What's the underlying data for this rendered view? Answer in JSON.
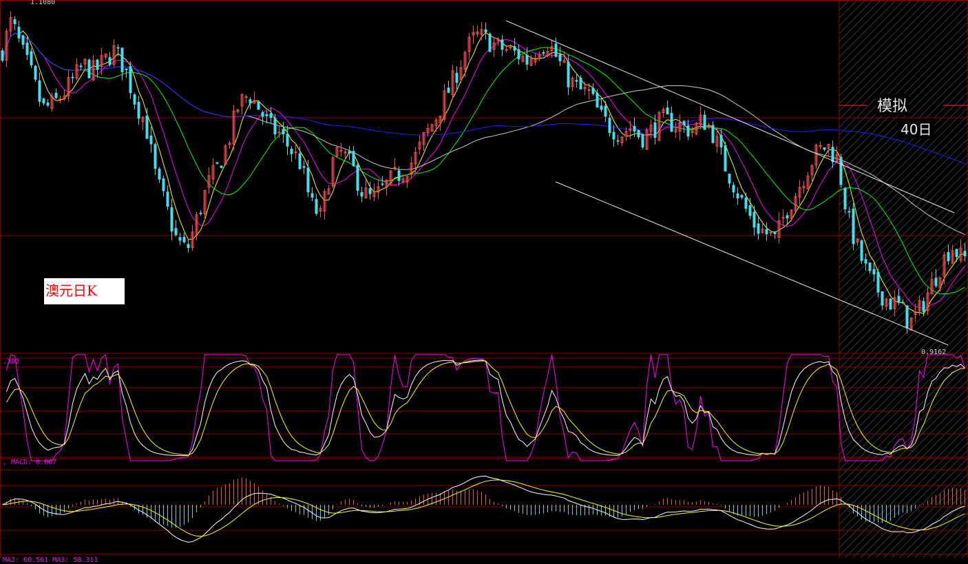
{
  "title_label": "澳元日K",
  "simulation": {
    "label": "模拟",
    "days": "40日"
  },
  "price_high_label": "1.1080",
  "price_low_label": "0.9162",
  "kdj_label": ".382",
  "macd_label": ", MACD: 0.007",
  "ma_label": "MA2: 60.561  MA3: 58.311",
  "colors": {
    "background": "#000000",
    "grid": "#8b0000",
    "candle_up": "#ff5050",
    "candle_down": "#40e0f0",
    "ma5": "#ffff00",
    "ma10": "#ff00ff",
    "ma20": "#00ff00",
    "ma60": "#cccccc",
    "ma120": "#2020ff",
    "trendline": "#e8e8e8"
  },
  "chart_data": [
    {
      "type": "candlestick",
      "title": "澳元日K",
      "ylim": [
        0.9162,
        1.108
      ],
      "y_max_label": "1.1080",
      "y_min_label": "0.9162",
      "simulation_period_days": 40,
      "trend": {
        "x_index": [
          0,
          15,
          30,
          45,
          60,
          75,
          90,
          105,
          120,
          135,
          150,
          165,
          180,
          195,
          210,
          225,
          240,
          255,
          270,
          285,
          300,
          315,
          330,
          345,
          360,
          375,
          390,
          405,
          420,
          435,
          450,
          465,
          480,
          495,
          510,
          525,
          540,
          555,
          570,
          585,
          600,
          615,
          630,
          645,
          660,
          675,
          690,
          705,
          720,
          735,
          750,
          765,
          780,
          795,
          810,
          825,
          840,
          855,
          870,
          885,
          900,
          915,
          930,
          945,
          960,
          975,
          990,
          1005,
          1020,
          1035,
          1050,
          1065,
          1080,
          1095,
          1110,
          1125,
          1140,
          1155,
          1170,
          1185,
          1200,
          1215,
          1230,
          1245,
          1260,
          1275,
          1290,
          1305,
          1320,
          1335,
          1350,
          1365,
          1380,
          1395
        ],
        "close": [
          1.08,
          1.098,
          1.082,
          1.068,
          1.05,
          1.052,
          1.058,
          1.066,
          1.074,
          1.07,
          1.076,
          1.082,
          1.072,
          1.054,
          1.042,
          1.012,
          0.996,
          0.978,
          0.972,
          0.99,
          1.008,
          1.018,
          1.032,
          1.052,
          1.058,
          1.05,
          1.04,
          1.036,
          1.028,
          1.02,
          0.998,
          0.99,
          1.02,
          1.026,
          1.018,
          1.004,
          1.0,
          1.006,
          1.012,
          1.016,
          1.022,
          1.034,
          1.044,
          1.056,
          1.068,
          1.082,
          1.09,
          1.088,
          1.084,
          1.082,
          1.08,
          1.076,
          1.084,
          1.086,
          1.076,
          1.066,
          1.06,
          1.058,
          1.046,
          1.04,
          1.036,
          1.04,
          1.034,
          1.038,
          1.044,
          1.042,
          1.04,
          1.038,
          1.044,
          1.036,
          1.02,
          1.008,
          0.996,
          0.986,
          0.982,
          0.978,
          0.994,
          1.004,
          1.016,
          1.026,
          1.03,
          1.022,
          0.99,
          0.972,
          0.958,
          0.95,
          0.944,
          0.942,
          0.932,
          0.94,
          0.952,
          0.964,
          0.975,
          0.968
        ]
      },
      "channel_lines": "downward parallel channel from the high toward the low",
      "moving_averages": [
        "MA5",
        "MA10",
        "MA20",
        "MA60",
        "MA120"
      ]
    },
    {
      "type": "line",
      "indicator": "KDJ",
      "label": ".382",
      "series": [
        "K",
        "D",
        "J"
      ]
    },
    {
      "type": "bar",
      "indicator": "MACD",
      "label": "MACD: 0.007",
      "series": [
        "DIF",
        "DEA",
        "MACD histogram"
      ]
    }
  ]
}
